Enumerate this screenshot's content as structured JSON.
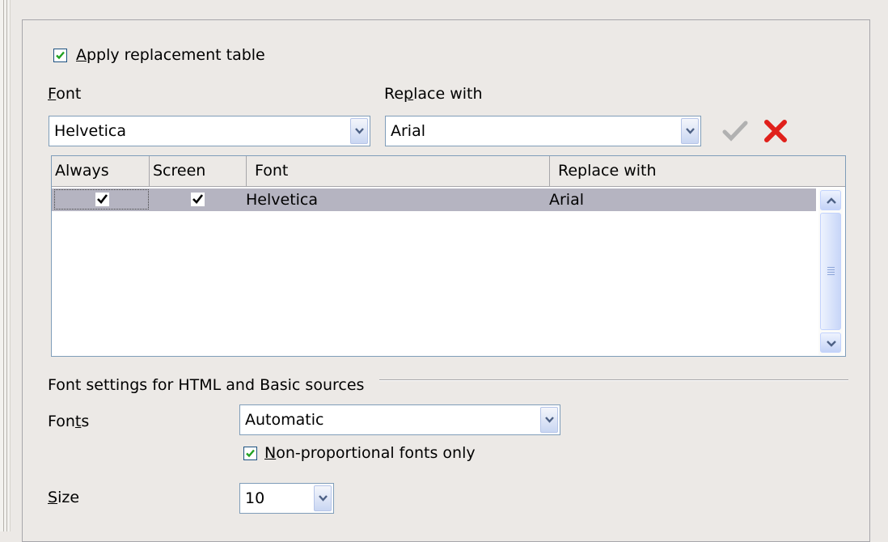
{
  "replacement": {
    "apply_label_u": "A",
    "apply_label_rest": "pply replacement table",
    "apply_checked": true,
    "font_label_u": "F",
    "font_label_rest": "ont",
    "replace_label_pre": "Re",
    "replace_label_u": "p",
    "replace_label_rest": "lace with",
    "font_value": "Helvetica",
    "replace_value": "Arial",
    "apply_icon": "checkmark-icon",
    "delete_icon": "red-x-delete-icon"
  },
  "table": {
    "columns": [
      "Always",
      "Screen",
      "Font",
      "Replace with"
    ],
    "rows": [
      {
        "always": true,
        "screen": true,
        "font": "Helvetica",
        "replace": "Arial"
      }
    ]
  },
  "html_settings": {
    "section_title": "Font settings for HTML and Basic sources",
    "fonts_label_pre": "Fon",
    "fonts_label_u": "t",
    "fonts_label_rest": "s",
    "fonts_value": "Automatic",
    "nonprop_label_u": "N",
    "nonprop_label_rest": "on-proportional fonts only",
    "nonprop_checked": true,
    "size_label_u": "S",
    "size_label_rest": "ize",
    "size_value": "10"
  },
  "colors": {
    "selected_row": "#b5b4c1",
    "check_green": "#21a121",
    "delete_red": "#e0201b"
  }
}
